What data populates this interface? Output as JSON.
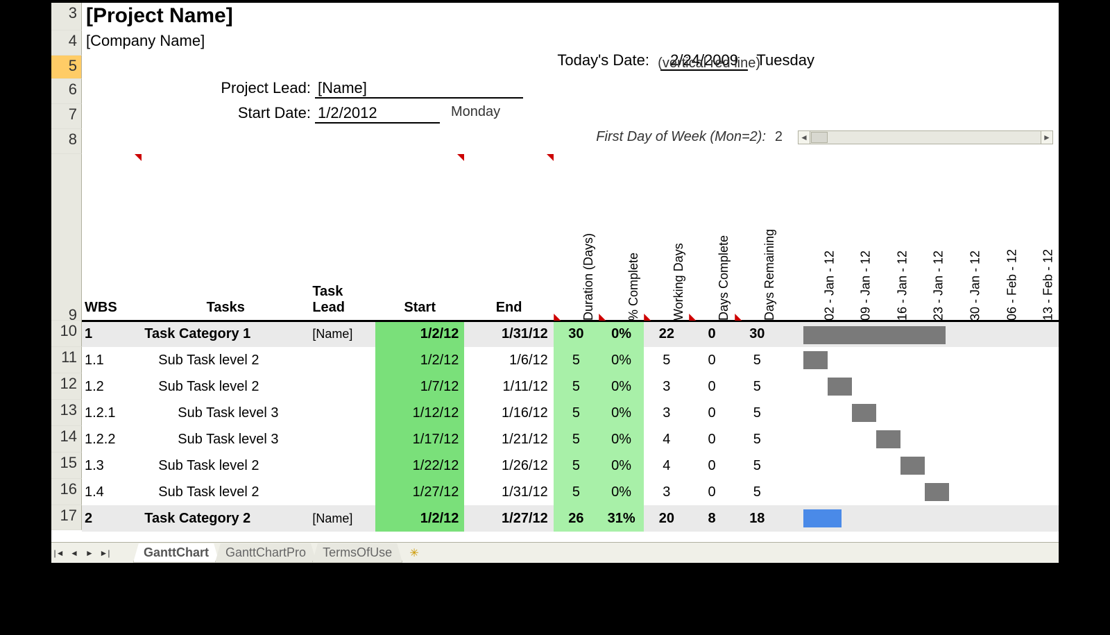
{
  "header": {
    "project_name": "[Project Name]",
    "company_name": "[Company Name]",
    "today_label": "Today's Date:",
    "today_date": "2/24/2009",
    "today_dayname": "Tuesday",
    "vertical_hint": "(vertical red line)",
    "lead_label": "Project Lead:",
    "lead_value": "[Name]",
    "startdate_label": "Start Date:",
    "startdate_value": "1/2/2012",
    "startdate_dayname": "Monday",
    "fdow_label": "First Day of Week (Mon=2):",
    "fdow_value": "2"
  },
  "row_headers": [
    "3",
    "4",
    "5",
    "6",
    "7",
    "8",
    "9",
    "10",
    "11",
    "12",
    "13",
    "14",
    "15",
    "16",
    "17"
  ],
  "columns": {
    "wbs": "WBS",
    "tasks": "Tasks",
    "lead": "Task Lead",
    "start": "Start",
    "end": "End",
    "duration": "Duration (Days)",
    "pct": "% Complete",
    "wdays": "Working Days",
    "dcomp": "Days Complete",
    "drem": "Days Remaining"
  },
  "gantt_headers": [
    "02 - Jan - 12",
    "09 - Jan - 12",
    "16 - Jan - 12",
    "23 - Jan - 12",
    "30 - Jan - 12",
    "06 - Feb - 12",
    "13 - Feb - 12"
  ],
  "rows": [
    {
      "wbs": "1",
      "task": "Task Category 1",
      "cat": true,
      "lead": "[Name]",
      "start": "1/2/12",
      "end": "1/31/12",
      "dur": "30",
      "pct": "0%",
      "wd": "22",
      "dc": "0",
      "dr": "30",
      "bar": {
        "start": 0,
        "len": 4.1,
        "cls": ""
      }
    },
    {
      "wbs": "1.1",
      "task": "Sub Task level 2",
      "lvl": 2,
      "start": "1/2/12",
      "end": "1/6/12",
      "dur": "5",
      "pct": "0%",
      "wd": "5",
      "dc": "0",
      "dr": "5",
      "bar": {
        "start": 0,
        "len": 0.7,
        "cls": ""
      }
    },
    {
      "wbs": "1.2",
      "task": "Sub Task level 2",
      "lvl": 2,
      "start": "1/7/12",
      "end": "1/11/12",
      "dur": "5",
      "pct": "0%",
      "wd": "3",
      "dc": "0",
      "dr": "5",
      "bar": {
        "start": 0.7,
        "len": 0.7,
        "cls": ""
      }
    },
    {
      "wbs": "1.2.1",
      "task": "Sub Task level 3",
      "lvl": 3,
      "start": "1/12/12",
      "end": "1/16/12",
      "dur": "5",
      "pct": "0%",
      "wd": "3",
      "dc": "0",
      "dr": "5",
      "bar": {
        "start": 1.4,
        "len": 0.7,
        "cls": ""
      }
    },
    {
      "wbs": "1.2.2",
      "task": "Sub Task level 3",
      "lvl": 3,
      "start": "1/17/12",
      "end": "1/21/12",
      "dur": "5",
      "pct": "0%",
      "wd": "4",
      "dc": "0",
      "dr": "5",
      "bar": {
        "start": 2.1,
        "len": 0.7,
        "cls": ""
      }
    },
    {
      "wbs": "1.3",
      "task": "Sub Task level 2",
      "lvl": 2,
      "start": "1/22/12",
      "end": "1/26/12",
      "dur": "5",
      "pct": "0%",
      "wd": "4",
      "dc": "0",
      "dr": "5",
      "bar": {
        "start": 2.8,
        "len": 0.7,
        "cls": ""
      }
    },
    {
      "wbs": "1.4",
      "task": "Sub Task level 2",
      "lvl": 2,
      "start": "1/27/12",
      "end": "1/31/12",
      "dur": "5",
      "pct": "0%",
      "wd": "3",
      "dc": "0",
      "dr": "5",
      "bar": {
        "start": 3.5,
        "len": 0.7,
        "cls": ""
      }
    },
    {
      "wbs": "2",
      "task": "Task Category 2",
      "cat": true,
      "lead": "[Name]",
      "start": "1/2/12",
      "end": "1/27/12",
      "dur": "26",
      "pct": "31%",
      "wd": "20",
      "dc": "8",
      "dr": "18",
      "bar": {
        "start": 0,
        "len": 1.1,
        "cls": "blue"
      }
    }
  ],
  "tabs": {
    "items": [
      "GanttChart",
      "GanttChartPro",
      "TermsOfUse"
    ],
    "active": 0
  }
}
